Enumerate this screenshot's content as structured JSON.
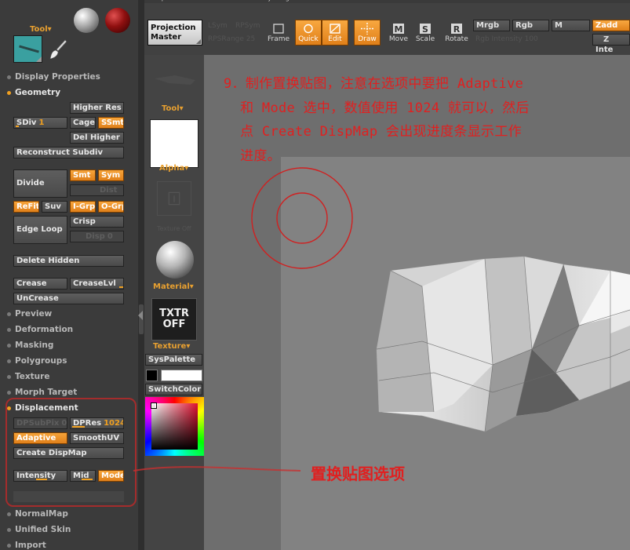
{
  "palette": {
    "panel_bg": "#3b3b3b",
    "accent_orange": "#f0a020",
    "canvas_bg": "#828282",
    "annotation_red": "#e02020"
  },
  "left_panel": {
    "tool_label": "Tool",
    "sections": {
      "display_properties": "Display Properties",
      "geometry": "Geometry",
      "preview": "Preview",
      "deformation": "Deformation",
      "masking": "Masking",
      "polygroups": "Polygroups",
      "texture": "Texture",
      "morph_target": "Morph Target",
      "displacement": "Displacement",
      "normalmap": "NormalMap",
      "unified_skin": "Unified Skin",
      "import": "Import"
    },
    "geometry": {
      "higher_res": "Higher Res",
      "sdiv_label": "SDiv",
      "sdiv_value": "1",
      "cage": "Cage",
      "ssmt": "SSmt",
      "del_higher": "Del Higher",
      "reconstruct_subdiv": "Reconstruct Subdiv",
      "divide": "Divide",
      "smt": "Smt",
      "sym": "Sym",
      "dist": "Dist",
      "refit": "ReFit",
      "suv": "Suv",
      "i_grp": "I-Grp",
      "o_grp": "O-Grp",
      "edge_loop": "Edge Loop",
      "crisp": "Crisp",
      "disp": "Disp",
      "disp_value": "0",
      "delete_hidden": "Delete Hidden",
      "crease": "Crease",
      "crease_lvl": "CreaseLvl",
      "uncrease": "UnCrease"
    },
    "displacement": {
      "dpsubpix": "DPSubPix",
      "dpsubpix_value": "0",
      "dpres_label": "DPRes",
      "dpres_value": "1024",
      "adaptive": "Adaptive",
      "smooth_uv": "SmoothUV",
      "create_dispmap": "Create DispMap",
      "intensity": "Intensity",
      "mid": "Mid",
      "mode": "Mode"
    }
  },
  "toolbar": {
    "menu_items": [
      "Alpha",
      "Color",
      "Document",
      "Draw",
      "Edit",
      "Layer",
      "Light",
      "Marker",
      "Material",
      "Movie",
      "Picker",
      "Preferences",
      "Render",
      "Stencil"
    ],
    "projection_master": "Projection\nMaster",
    "ghost_row1": [
      "LSym",
      "RPSym"
    ],
    "ghost_row2": [
      "RPSRange",
      "25"
    ],
    "frame": "Frame",
    "quick": "Quick",
    "edit": "Edit",
    "draw": "Draw",
    "move": "Move",
    "scale": "Scale",
    "rotate": "Rotate",
    "mrgb": "Mrgb",
    "rgb": "Rgb",
    "m": "M",
    "zadd": "Zadd",
    "rgb_intensity_label": "Rgb Intensity",
    "rgb_intensity_value": "100",
    "z_intensity": "Z Inte"
  },
  "mid_column": {
    "tool_label": "Tool",
    "alpha_label": "Alpha",
    "texture_ghost": "Texture Off",
    "material_label": "Material",
    "txtr_off": "TXTR\nOFF",
    "texture_label": "Texture",
    "syspalette": "SysPalette",
    "switchcolor": "SwitchColor"
  },
  "annotations": {
    "instruction": "9．制作置换贴图，注意在选项中要把 Adaptive\n  和 Mode 选中，数值使用 1024 就可以，然后\n  点 Create DispMap 会出现进度条显示工作\n  进度。",
    "callout": "置换贴图选项"
  }
}
